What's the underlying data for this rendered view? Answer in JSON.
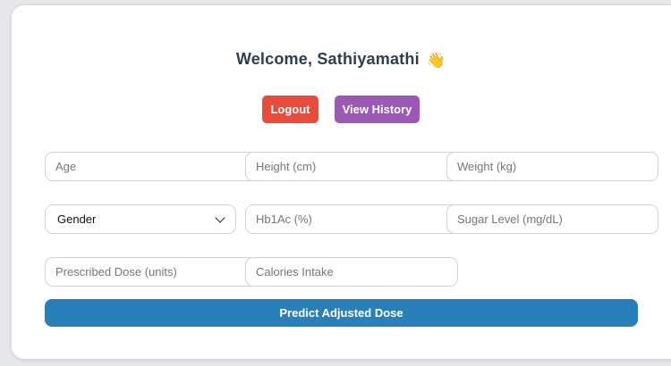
{
  "header": {
    "welcome_text": "Welcome, Sathiyamathi",
    "wave_emoji": "👋"
  },
  "actions": {
    "logout_label": "Logout",
    "history_label": "View History"
  },
  "form": {
    "age_placeholder": "Age",
    "height_placeholder": "Height (cm)",
    "weight_placeholder": "Weight (kg)",
    "gender_selected": "Gender",
    "hba1c_placeholder": "Hb1Ac (%)",
    "sugar_placeholder": "Sugar Level (mg/dL)",
    "dose_placeholder": "Prescribed Dose (units)",
    "calories_placeholder": "Calories Intake",
    "submit_label": "Predict Adjusted Dose"
  },
  "colors": {
    "logout": "#e74c3c",
    "history": "#9b59b6",
    "predict": "#2980b9",
    "title": "#2c3e50"
  }
}
